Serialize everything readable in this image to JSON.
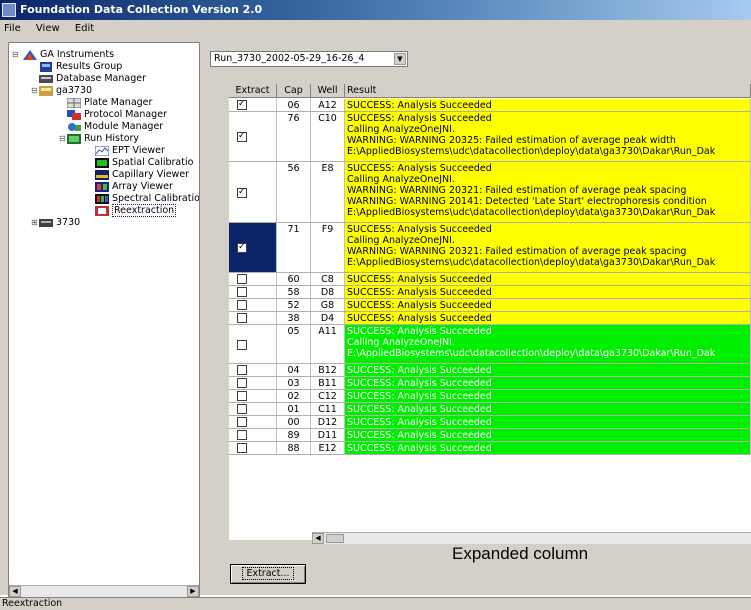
{
  "window": {
    "title": "Foundation Data Collection Version 2.0"
  },
  "menu": {
    "file": "File",
    "view": "View",
    "edit": "Edit"
  },
  "tree": {
    "root": "GA Instruments",
    "results_group": "Results Group",
    "database_manager": "Database Manager",
    "instrument": "ga3730",
    "plate_manager": "Plate Manager",
    "protocol_manager": "Protocol Manager",
    "module_manager": "Module Manager",
    "run_history": "Run History",
    "ept_viewer": "EPT Viewer",
    "spatial_calibration": "Spatial Calibratio",
    "capillary_viewer": "Capillary Viewer",
    "array_viewer": "Array Viewer",
    "spectral_calibration": "Spectral Calibratio",
    "reextraction": "Reextraction",
    "other_instrument": "3730"
  },
  "run_select": {
    "value": "Run_3730_2002-05-29_16-26_4"
  },
  "table": {
    "headers": {
      "extract": "Extract",
      "cap": "Cap",
      "well": "Well",
      "result": "Result"
    },
    "rows": [
      {
        "checked": true,
        "cap": "06",
        "well": "A12",
        "status": "yellow",
        "lines": [
          "SUCCESS: Analysis Succeeded"
        ]
      },
      {
        "checked": true,
        "cap": "76",
        "well": "C10",
        "status": "yellow",
        "lines": [
          "SUCCESS: Analysis Succeeded",
          "Calling AnalyzeOneJNI.",
          "WARNING: WARNING 20325: Failed estimation of average peak width",
          "E:\\AppliedBiosystems\\udc\\datacollection\\deploy\\data\\ga3730\\Dakar\\Run_Dak"
        ]
      },
      {
        "checked": true,
        "cap": "56",
        "well": "E8",
        "status": "yellow",
        "lines": [
          "SUCCESS: Analysis Succeeded",
          "Calling AnalyzeOneJNI.",
          "WARNING: WARNING 20321: Failed estimation of average peak spacing",
          "WARNING: WARNING 20141: Detected 'Late Start' electrophoresis condition",
          "E:\\AppliedBiosystems\\udc\\datacollection\\deploy\\data\\ga3730\\Dakar\\Run_Dak"
        ]
      },
      {
        "checked": true,
        "cap": "71",
        "well": "F9",
        "status": "yellow",
        "selected": true,
        "lines": [
          "SUCCESS: Analysis Succeeded",
          "Calling AnalyzeOneJNI.",
          "WARNING: WARNING 20321: Failed estimation of average peak spacing",
          "E:\\AppliedBiosystems\\udc\\datacollection\\deploy\\data\\ga3730\\Dakar\\Run_Dak"
        ]
      },
      {
        "checked": false,
        "cap": "60",
        "well": "C8",
        "status": "yellow",
        "lines": [
          "SUCCESS: Analysis Succeeded"
        ]
      },
      {
        "checked": false,
        "cap": "58",
        "well": "D8",
        "status": "yellow",
        "lines": [
          "SUCCESS: Analysis Succeeded"
        ]
      },
      {
        "checked": false,
        "cap": "52",
        "well": "G8",
        "status": "yellow",
        "lines": [
          "SUCCESS: Analysis Succeeded"
        ]
      },
      {
        "checked": false,
        "cap": "38",
        "well": "D4",
        "status": "yellow",
        "lines": [
          "SUCCESS: Analysis Succeeded"
        ]
      },
      {
        "checked": false,
        "cap": "05",
        "well": "A11",
        "status": "green",
        "lines": [
          "SUCCESS: Analysis Succeeded",
          "Calling AnalyzeOneJNI.",
          "E:\\AppliedBiosystems\\udc\\datacollection\\deploy\\data\\ga3730\\Dakar\\Run_Dak"
        ]
      },
      {
        "checked": false,
        "cap": "04",
        "well": "B12",
        "status": "green",
        "lines": [
          "SUCCESS: Analysis Succeeded"
        ]
      },
      {
        "checked": false,
        "cap": "03",
        "well": "B11",
        "status": "green",
        "lines": [
          "SUCCESS: Analysis Succeeded"
        ]
      },
      {
        "checked": false,
        "cap": "02",
        "well": "C12",
        "status": "green",
        "lines": [
          "SUCCESS: Analysis Succeeded"
        ]
      },
      {
        "checked": false,
        "cap": "01",
        "well": "C11",
        "status": "green",
        "lines": [
          "SUCCESS: Analysis Succeeded"
        ]
      },
      {
        "checked": false,
        "cap": "00",
        "well": "D12",
        "status": "green",
        "lines": [
          "SUCCESS: Analysis Succeeded"
        ]
      },
      {
        "checked": false,
        "cap": "89",
        "well": "D11",
        "status": "green",
        "lines": [
          "SUCCESS: Analysis Succeeded"
        ]
      },
      {
        "checked": false,
        "cap": "88",
        "well": "E12",
        "status": "green",
        "lines": [
          "SUCCESS: Analysis Succeeded"
        ]
      }
    ]
  },
  "colors": {
    "yellow": "#ffff00",
    "green": "#00ee00",
    "selected": "#0a246a"
  },
  "caption": "Expanded column",
  "extract_button": "Extract...",
  "status_bar": "Reextraction"
}
